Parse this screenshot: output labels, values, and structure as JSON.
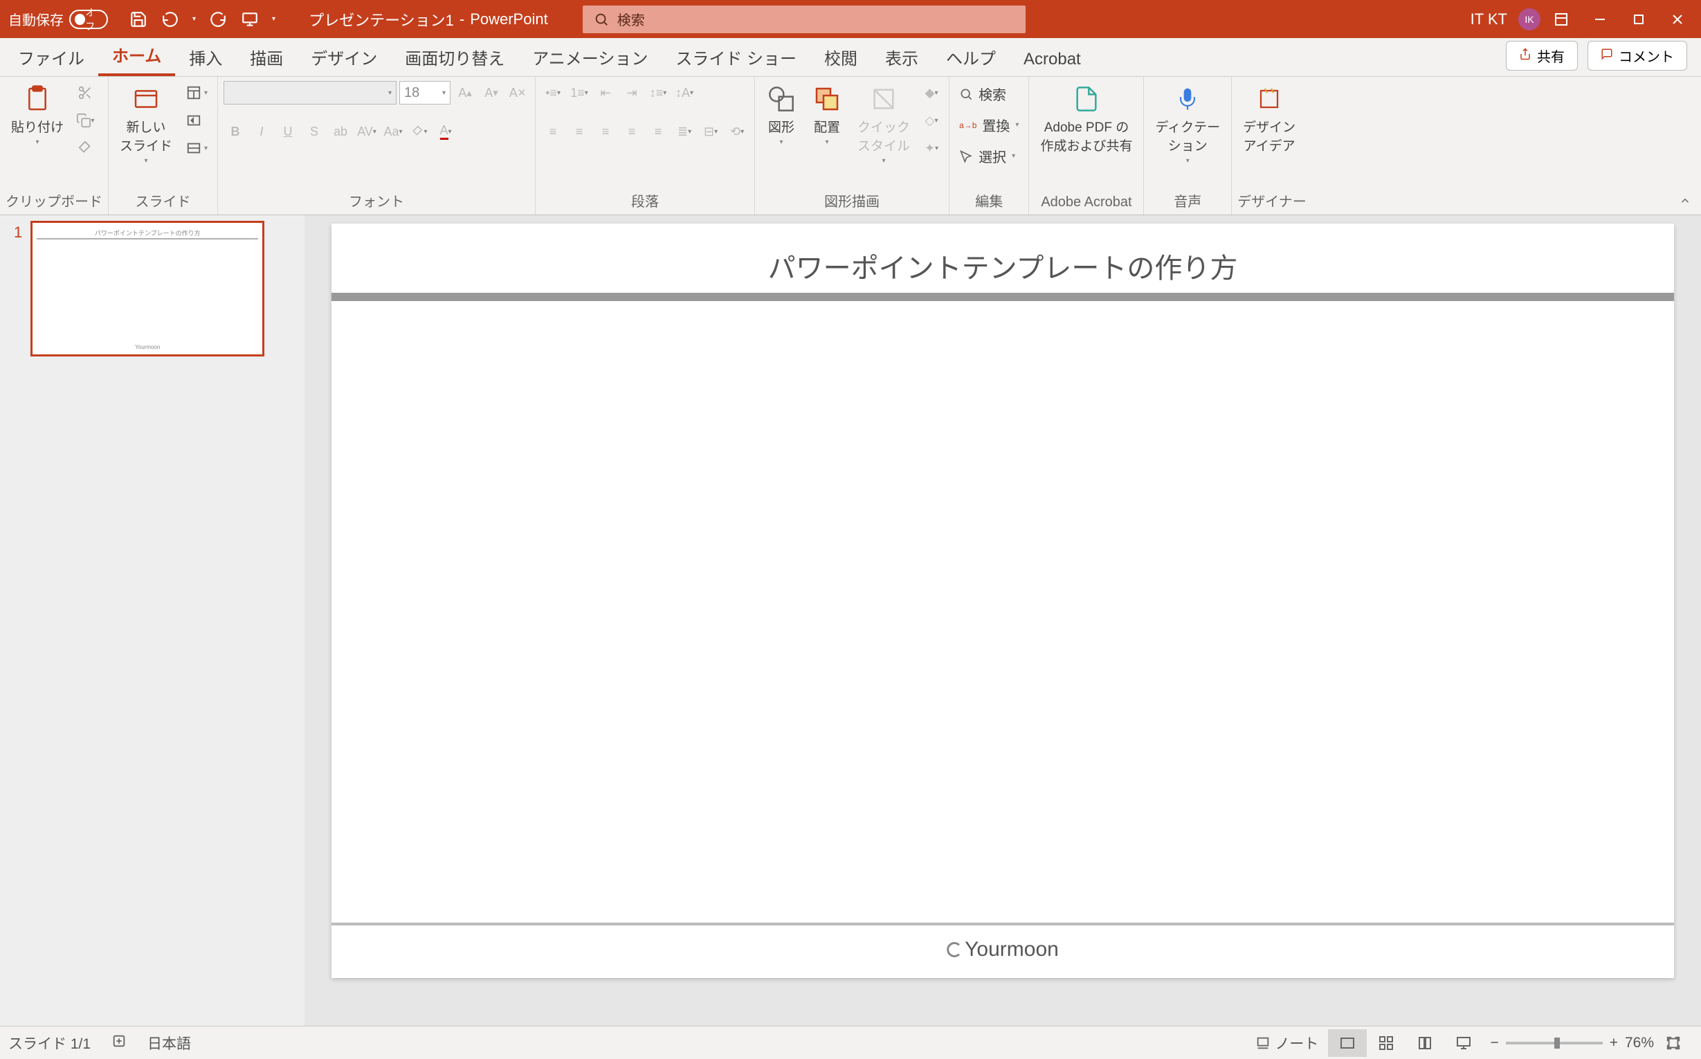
{
  "titlebar": {
    "autosave_label": "自動保存",
    "autosave_state": "オフ",
    "doc_name": "プレゼンテーション1",
    "app_name": "PowerPoint",
    "search_placeholder": "検索",
    "account_name": "IT KT",
    "avatar_initials": "IK"
  },
  "tabs": {
    "file": "ファイル",
    "home": "ホーム",
    "insert": "挿入",
    "draw": "描画",
    "design": "デザイン",
    "transitions": "画面切り替え",
    "animations": "アニメーション",
    "slideshow": "スライド ショー",
    "review": "校閲",
    "view": "表示",
    "help": "ヘルプ",
    "acrobat": "Acrobat",
    "share": "共有",
    "comment": "コメント"
  },
  "ribbon": {
    "clipboard": {
      "label": "クリップボード",
      "paste": "貼り付け"
    },
    "slides": {
      "label": "スライド",
      "new_slide": "新しい\nスライド"
    },
    "font": {
      "label": "フォント",
      "size": "18"
    },
    "paragraph": {
      "label": "段落"
    },
    "drawing": {
      "label": "図形描画",
      "shape": "図形",
      "arrange": "配置",
      "quick": "クイック\nスタイル"
    },
    "editing": {
      "label": "編集",
      "find": "検索",
      "replace": "置換",
      "select": "選択"
    },
    "adobe": {
      "label": "Adobe Acrobat",
      "create": "Adobe PDF の\n作成および共有"
    },
    "voice": {
      "label": "音声",
      "dictate": "ディクテー\nション"
    },
    "designer": {
      "label": "デザイナー",
      "ideas": "デザイン\nアイデア"
    }
  },
  "thumbnails": [
    {
      "number": "1",
      "title": "パワーポイントテンプレートの作り方",
      "footer": "Yourmoon"
    }
  ],
  "slide": {
    "title": "パワーポイントテンプレートの作り方",
    "footer_logo": "Yourmoon"
  },
  "statusbar": {
    "slide_counter": "スライド 1/1",
    "language": "日本語",
    "notes": "ノート",
    "zoom_pct": "76%"
  }
}
